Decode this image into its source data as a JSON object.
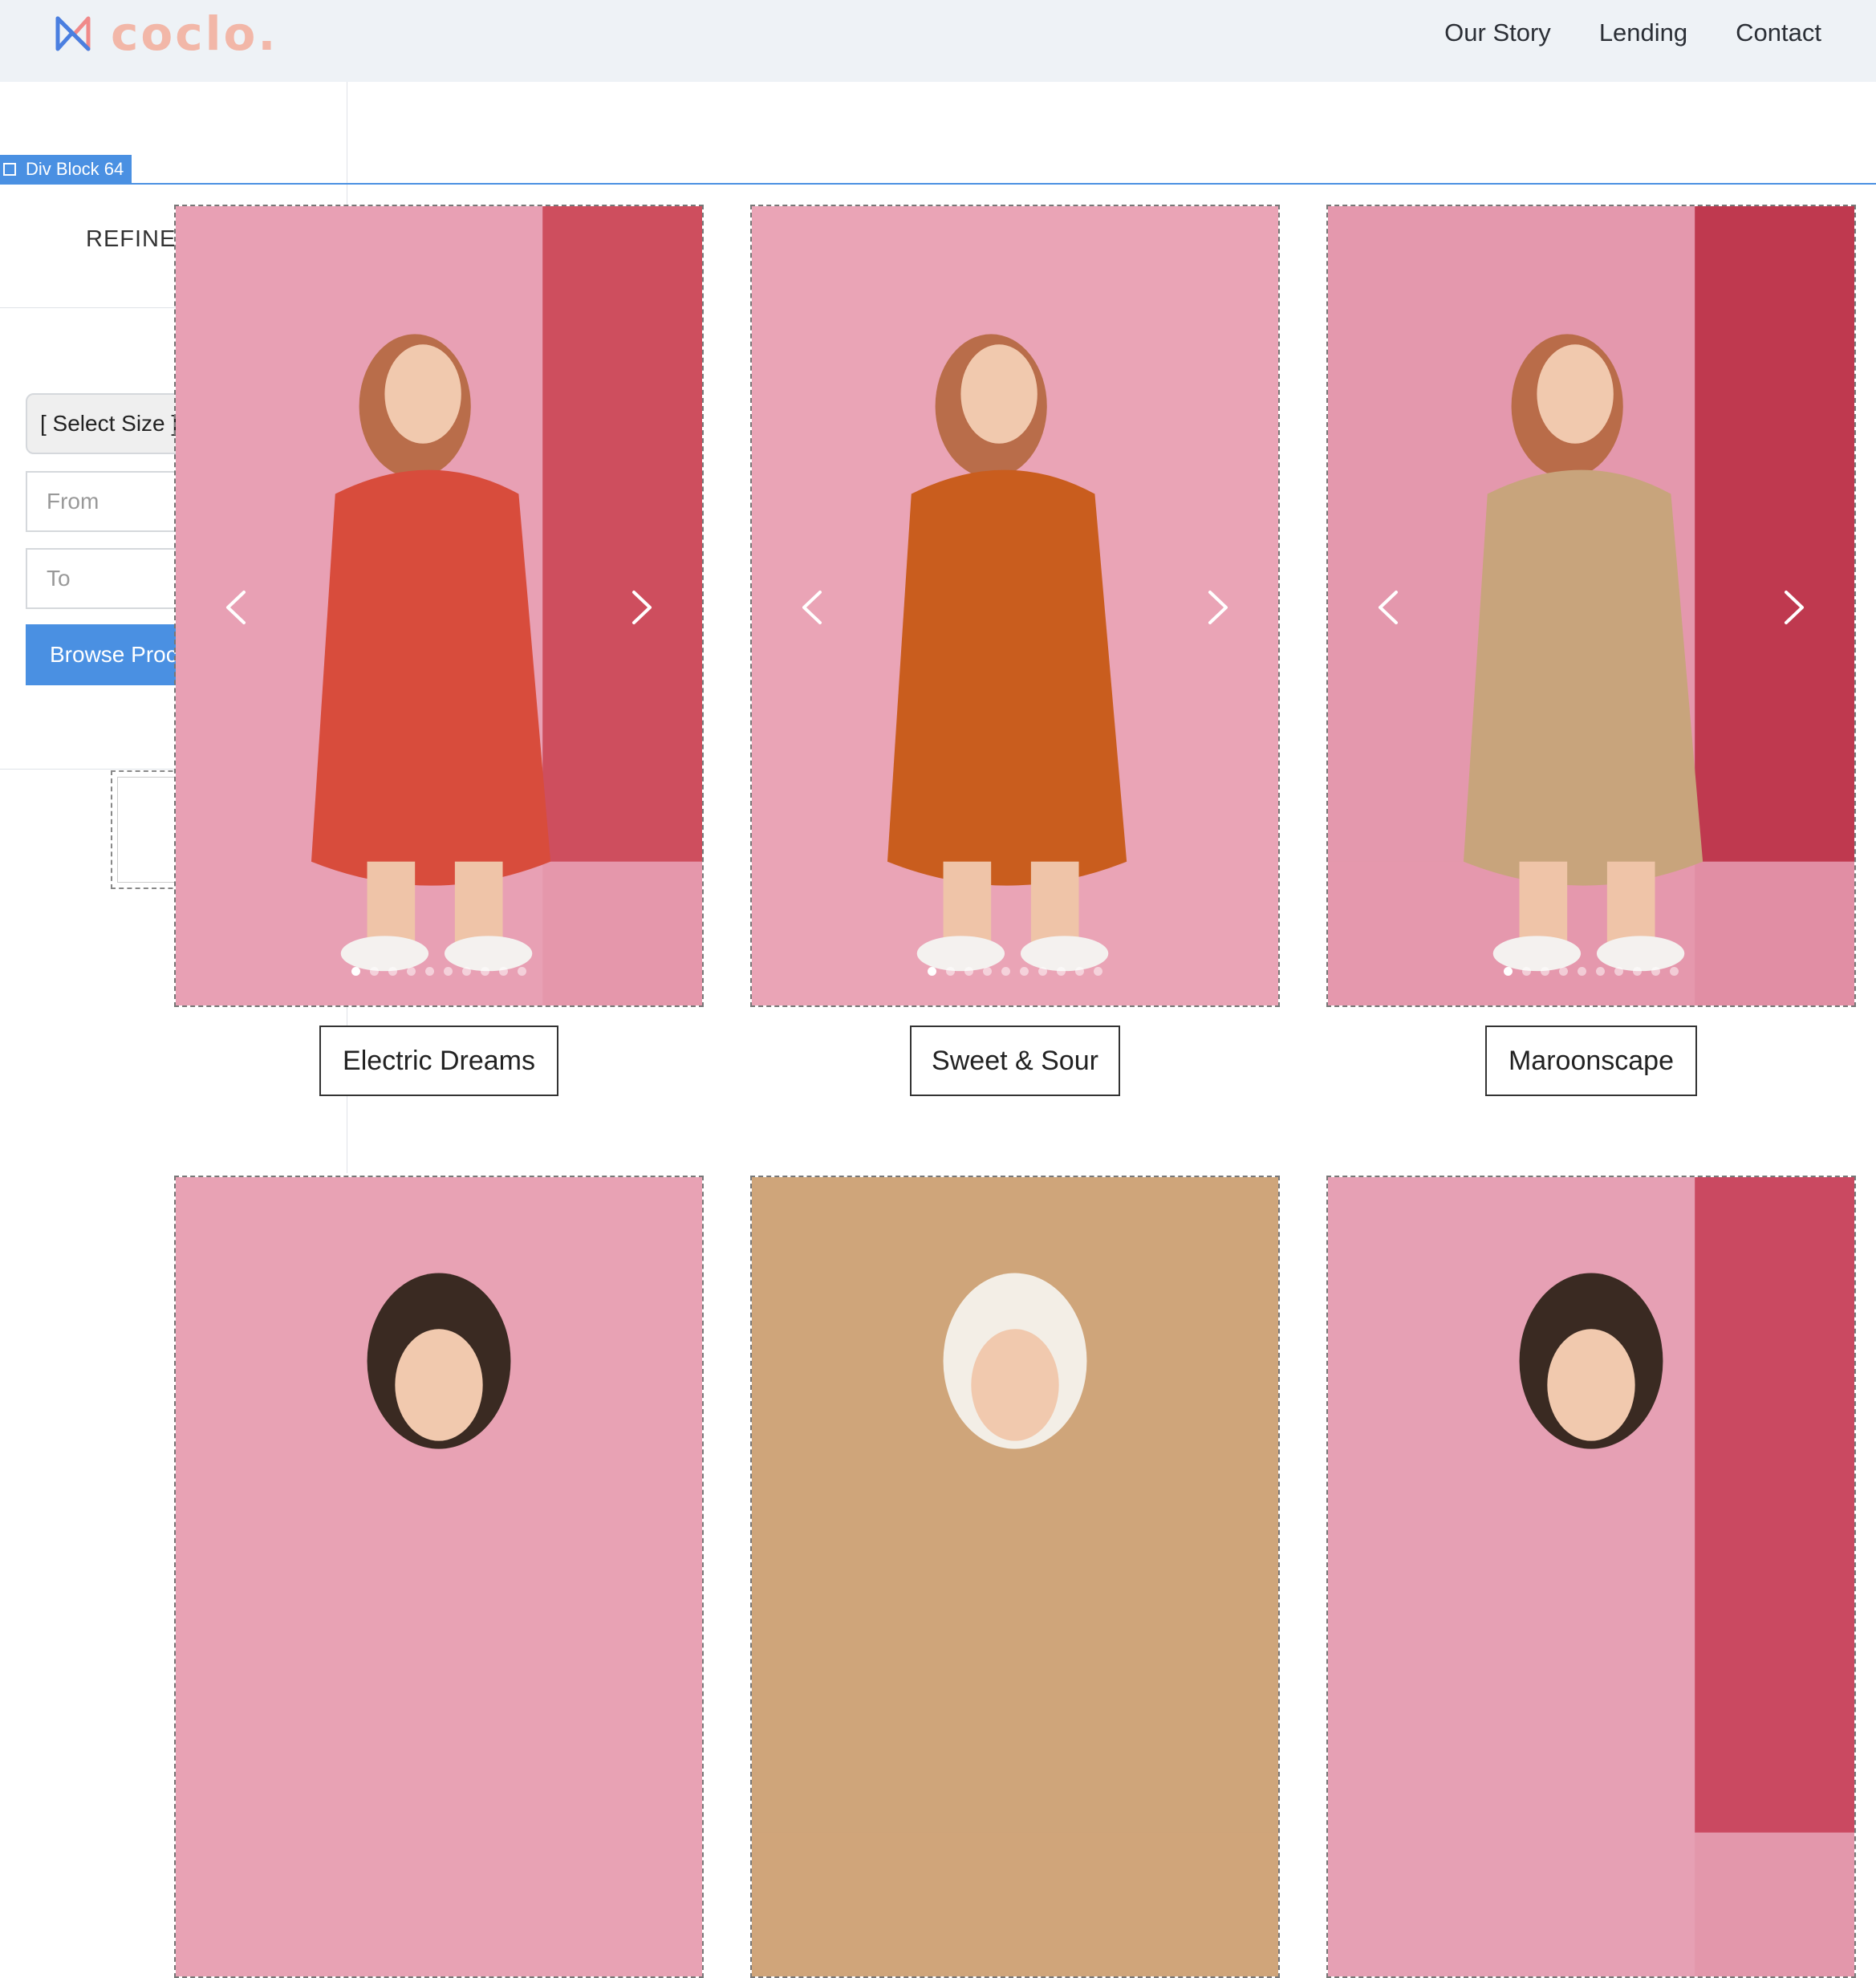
{
  "brand": {
    "name": "coclo.",
    "logo_color": "#f2b7a8",
    "mark_colors": [
      "#4a7fe0",
      "#f08a8a"
    ]
  },
  "nav": {
    "items": [
      "Our Story",
      "Lending",
      "Contact"
    ]
  },
  "editor": {
    "selected_element_label": "Div Block 64",
    "highlight_color": "#4a90e2"
  },
  "filter": {
    "heading": "REFINE S",
    "size_select": "[ Select Size ]",
    "from_placeholder": "From",
    "to_placeholder": "To",
    "browse_button": "Browse Proc"
  },
  "products": [
    {
      "title": "Electric Dreams",
      "slide_count": 10,
      "active_slide": 1,
      "background": "#e8a0b4",
      "accent": "#c9404f",
      "outfit_color": "#d84c3c"
    },
    {
      "title": "Sweet & Sour",
      "slide_count": 10,
      "active_slide": 1,
      "background": "#eaa4b6",
      "accent": "#e9a4b5",
      "outfit_color": "#c95d1e"
    },
    {
      "title": "Maroonscape",
      "slide_count": 10,
      "active_slide": 1,
      "background": "#e498ad",
      "accent": "#b8283e",
      "outfit_color": "#c8a47c"
    },
    {
      "background": "#e8a2b4",
      "accent": "#e8a2b4",
      "outfit_color": "#1f5d5a"
    },
    {
      "background": "#cfa57a",
      "accent": "#cfa57a",
      "outfit_color": "#f1ece2"
    },
    {
      "background": "#e6a0b4",
      "accent": "#c43a52",
      "outfit_color": "#2a2522"
    }
  ]
}
